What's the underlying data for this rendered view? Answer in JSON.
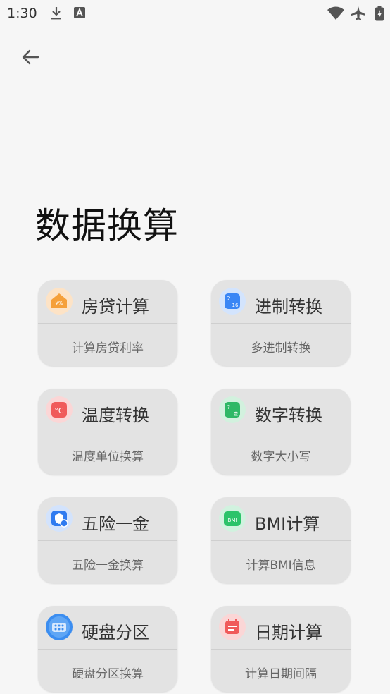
{
  "status_bar": {
    "time": "1:30",
    "icons": [
      "download-icon",
      "keyboard-icon",
      "wifi-icon",
      "airplane-mode-icon",
      "battery-icon"
    ]
  },
  "header": {
    "title": "数据换算"
  },
  "cards": [
    {
      "title": "房贷计算",
      "subtitle": "计算房贷利率",
      "icon": "house-loan-icon",
      "accent": "#f5a03a"
    },
    {
      "title": "进制转换",
      "subtitle": "多进制转换",
      "icon": "base-convert-icon",
      "accent": "#3a86f5"
    },
    {
      "title": "温度转换",
      "subtitle": "温度单位换算",
      "icon": "temperature-icon",
      "accent": "#f05a5a"
    },
    {
      "title": "数字转换",
      "subtitle": "数字大小写",
      "icon": "number-convert-icon",
      "accent": "#2fb866"
    },
    {
      "title": "五险一金",
      "subtitle": "五险一金换算",
      "icon": "insurance-shield-icon",
      "accent": "#2f7bf0"
    },
    {
      "title": "BMI计算",
      "subtitle": "计算BMI信息",
      "icon": "bmi-scale-icon",
      "accent": "#2cc36a"
    },
    {
      "title": "硬盘分区",
      "subtitle": "硬盘分区换算",
      "icon": "disk-partition-icon",
      "accent": "#3b8df0"
    },
    {
      "title": "日期计算",
      "subtitle": "计算日期间隔",
      "icon": "calendar-icon",
      "accent": "#f05a5a"
    }
  ]
}
